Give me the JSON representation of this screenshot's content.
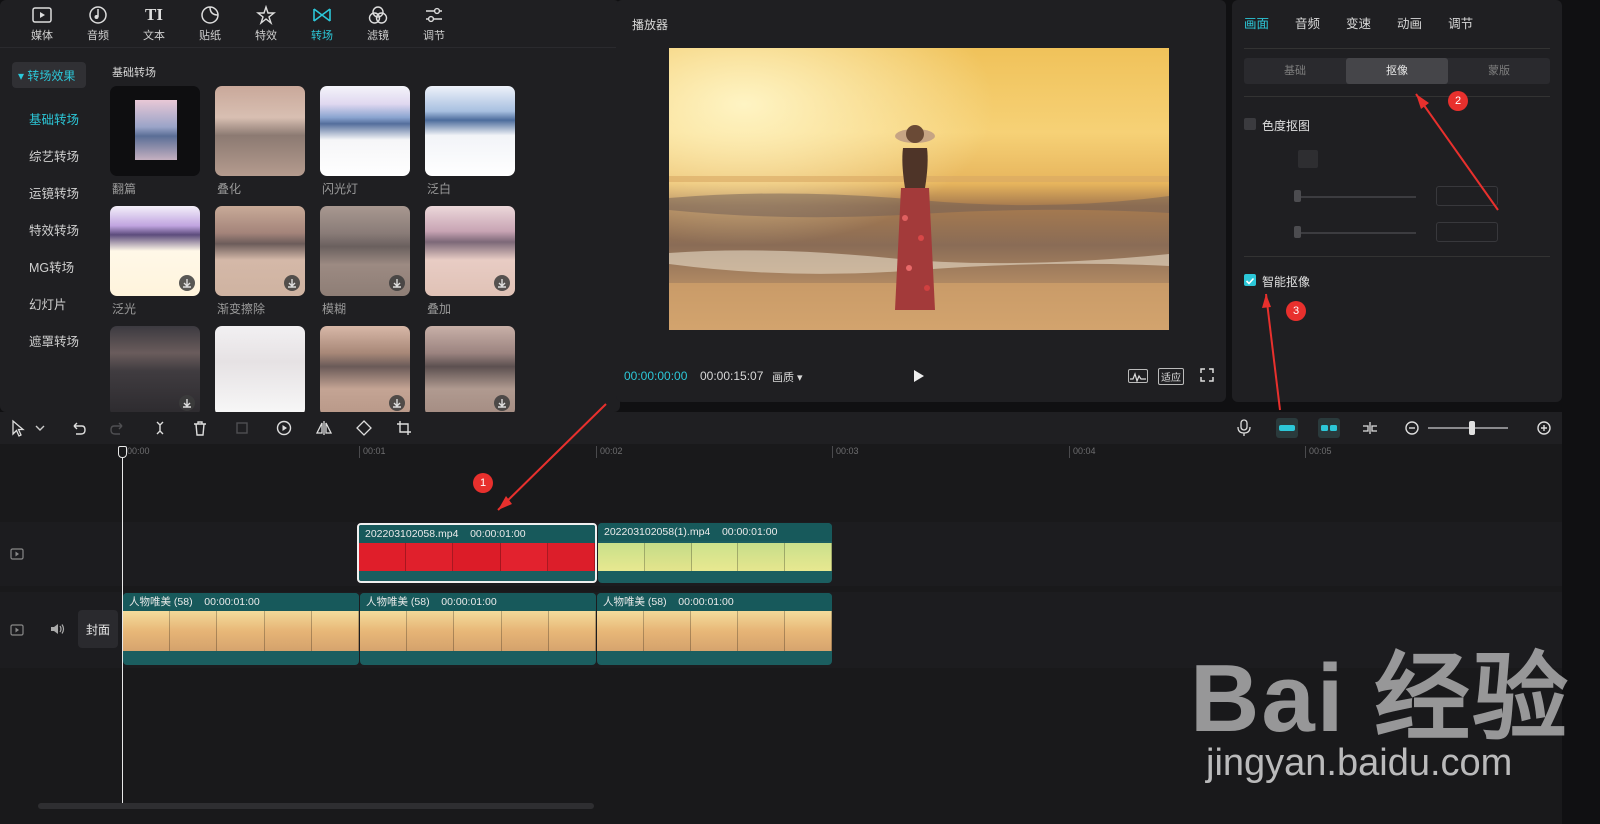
{
  "media": {
    "tabs": [
      {
        "label": "媒体",
        "icon": "media-icon"
      },
      {
        "label": "音频",
        "icon": "audio-icon"
      },
      {
        "label": "文本",
        "icon": "text-icon"
      },
      {
        "label": "贴纸",
        "icon": "sticker-icon"
      },
      {
        "label": "特效",
        "icon": "effects-icon"
      },
      {
        "label": "转场",
        "icon": "transition-icon"
      },
      {
        "label": "滤镜",
        "icon": "filter-icon"
      },
      {
        "label": "调节",
        "icon": "adjust-icon"
      }
    ],
    "active_tab": "转场",
    "nav": {
      "header": "▾ 转场效果",
      "items": [
        "基础转场",
        "综艺转场",
        "运镜转场",
        "特效转场",
        "MG转场",
        "幻灯片",
        "遮罩转场"
      ]
    },
    "section_title": "基础转场",
    "transitions": [
      "翻篇",
      "叠化",
      "闪光灯",
      "泛白",
      "泛光",
      "渐变擦除",
      "模糊",
      "叠加"
    ]
  },
  "player": {
    "title": "播放器",
    "current_time": "00:00:00:00",
    "total_time": "00:00:15:07",
    "quality": "画质 ▾",
    "fit": "适应"
  },
  "props": {
    "tabs": [
      "画面",
      "音频",
      "变速",
      "动画",
      "调节"
    ],
    "active_tab": "画面",
    "segments": [
      "基础",
      "抠像",
      "蒙版"
    ],
    "active_segment": "抠像",
    "chroma_key": {
      "label": "色度抠图",
      "checked": false
    },
    "smart_cutout": {
      "label": "智能抠像",
      "checked": true
    }
  },
  "timeline": {
    "ruler": [
      "00:00",
      "00:01",
      "00:02",
      "00:03",
      "00:04",
      "00:05"
    ],
    "cover_label": "封面",
    "upper_clips": [
      {
        "name": "202203102058.mp4",
        "duration": "00:00:01:00"
      },
      {
        "name": "202203102058(1).mp4",
        "duration": "00:00:01:00"
      }
    ],
    "lower_clips": [
      {
        "name": "人物唯美 (58)",
        "duration": "00:00:01:00"
      },
      {
        "name": "人物唯美 (58)",
        "duration": "00:00:01:00"
      },
      {
        "name": "人物唯美 (58)",
        "duration": "00:00:01:00"
      }
    ]
  },
  "markers": [
    "1",
    "2",
    "3"
  ],
  "watermark": {
    "brand": "Bai 经验",
    "url": "jingyan.baidu.com"
  },
  "colors": {
    "accent": "#2cc7d8",
    "marker": "#e8302d",
    "clip": "#1b5e60"
  }
}
